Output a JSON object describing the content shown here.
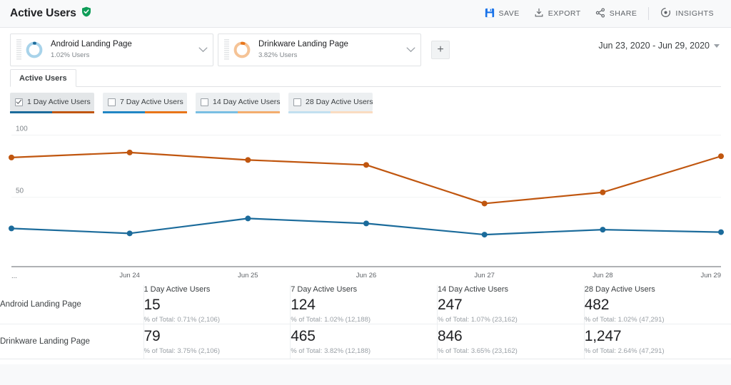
{
  "header": {
    "title": "Active Users",
    "verified_icon": "shield-check-icon",
    "actions": [
      {
        "label": "SAVE",
        "icon": "save-icon"
      },
      {
        "label": "EXPORT",
        "icon": "export-icon"
      },
      {
        "label": "SHARE",
        "icon": "share-icon"
      },
      {
        "label": "INSIGHTS",
        "icon": "insights-icon"
      }
    ]
  },
  "segments": [
    {
      "name": "Android Landing Page",
      "sub": "1.02% Users",
      "color": "#a8d3ea",
      "icon": "donut-icon",
      "chevron": "chevron-down-icon"
    },
    {
      "name": "Drinkware Landing Page",
      "sub": "3.82% Users",
      "color": "#f5c396",
      "icon": "donut-icon",
      "chevron": "chevron-down-icon"
    }
  ],
  "add_segment_label": "+",
  "date_range": "Jun 23, 2020 - Jun 29, 2020",
  "tabs": [
    {
      "label": "Active Users",
      "selected": true
    }
  ],
  "metric_chips": [
    {
      "label": "1 Day Active Users",
      "checked": true,
      "c1": "#1b6b9b",
      "c2": "#c0560f"
    },
    {
      "label": "7 Day Active Users",
      "checked": false,
      "c1": "#2186c4",
      "c2": "#e8751a"
    },
    {
      "label": "14 Day Active Users",
      "checked": false,
      "c1": "#79bfe3",
      "c2": "#f3ad6e"
    },
    {
      "label": "28 Day Active Users",
      "checked": false,
      "c1": "#c2e0f0",
      "c2": "#fadcc1"
    }
  ],
  "chart_data": {
    "type": "line",
    "title": "Active Users",
    "xlabel": "",
    "ylabel": "",
    "x": [
      "...",
      "Jun 24",
      "Jun 25",
      "Jun 26",
      "Jun 27",
      "Jun 28",
      "Jun 29"
    ],
    "x_first_label": "...",
    "yticks": [
      50,
      100
    ],
    "ylim": [
      0,
      110
    ],
    "grid": true,
    "legend_position": "top",
    "series": [
      {
        "name": "Android Landing Page",
        "color": "#1b6b9b",
        "values": [
          25,
          21,
          33,
          29,
          20,
          24,
          22
        ]
      },
      {
        "name": "Drinkware Landing Page",
        "color": "#c0560f",
        "values": [
          82,
          86,
          80,
          76,
          45,
          54,
          83
        ]
      }
    ]
  },
  "table": {
    "columns": [
      "",
      "1 Day Active Users",
      "7 Day Active Users",
      "14 Day Active Users",
      "28 Day Active Users"
    ],
    "rows": [
      {
        "name": "Android Landing Page",
        "cells": [
          {
            "header": "1 Day Active Users",
            "value": "15",
            "sub": "% of Total: 0.71% (2,106)"
          },
          {
            "header": "7 Day Active Users",
            "value": "124",
            "sub": "% of Total: 1.02% (12,188)"
          },
          {
            "header": "14 Day Active Users",
            "value": "247",
            "sub": "% of Total: 1.07% (23,162)"
          },
          {
            "header": "28 Day Active Users",
            "value": "482",
            "sub": "% of Total: 1.02% (47,291)"
          }
        ]
      },
      {
        "name": "Drinkware Landing Page",
        "cells": [
          {
            "header": "",
            "value": "79",
            "sub": "% of Total: 3.75% (2,106)"
          },
          {
            "header": "",
            "value": "465",
            "sub": "% of Total: 3.82% (12,188)"
          },
          {
            "header": "",
            "value": "846",
            "sub": "% of Total: 3.65% (23,162)"
          },
          {
            "header": "",
            "value": "1,247",
            "sub": "% of Total: 2.64% (47,291)"
          }
        ]
      }
    ]
  }
}
